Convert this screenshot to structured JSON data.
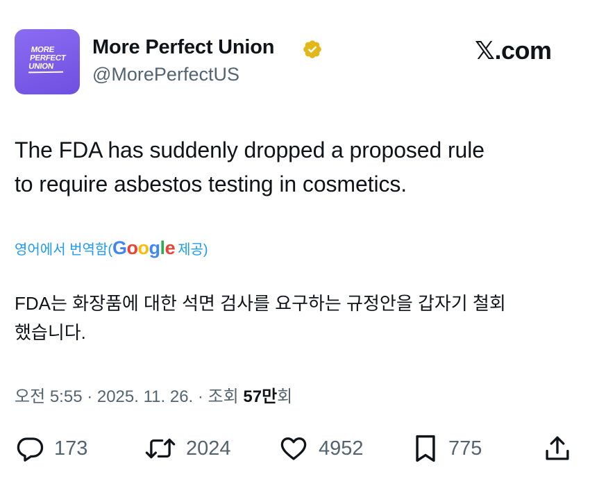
{
  "author": {
    "avatar_text": [
      "MORE",
      "PERFECT",
      "UNION"
    ],
    "display_name": "More Perfect Union",
    "handle": "@MorePerfectUS",
    "verified_color": "#e2b719"
  },
  "site": {
    "logo": "𝕏",
    "logo_suffix": ".com"
  },
  "tweet": {
    "lines": [
      "The FDA has suddenly dropped a proposed rule",
      "to require asbestos testing in cosmetics."
    ]
  },
  "translation": {
    "prefix": "영어에서 번역함(",
    "provider_letters": [
      "G",
      "o",
      "o",
      "g",
      "l",
      "e"
    ],
    "suffix": " 제공)",
    "lines": [
      "FDA는 화장품에 대한 석면 검사를 요구하는 규정안을 갑자기 철회",
      "했습니다."
    ]
  },
  "meta": {
    "time": "오전 5:55 · 2025. 11. 26. · 조회 ",
    "views": "57만",
    "views_suffix": "회"
  },
  "actions": {
    "replies": "173",
    "reposts": "2024",
    "likes": "4952",
    "bookmarks": "775"
  },
  "colors": {
    "link": "#1d9bf0",
    "secondary_text": "#536471",
    "primary_text": "#0f1419",
    "avatar_bg": "#7b5ce8"
  }
}
